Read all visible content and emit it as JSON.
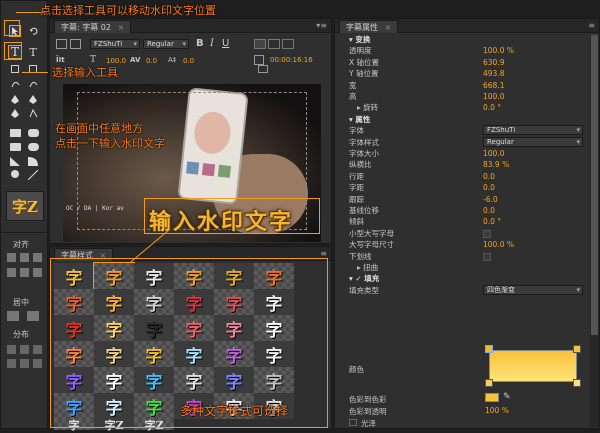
{
  "titler": {
    "tab_label": "字幕: 字幕 02",
    "font_family": "FZShuTi",
    "font_style": "Regular",
    "size": "100.0",
    "kerning": "0.0",
    "leading": "0.0",
    "timecode": "00:00:16:16",
    "text_tool_label": "T",
    "vertical_text_label": "T"
  },
  "left_panel": {
    "align_label": "对齐",
    "center_label": "居中",
    "distribute_label": "分布",
    "style_preview": "字Z"
  },
  "video": {
    "watermark_text": "输入水印文字",
    "ticker_text": "OC / DA | Kor av"
  },
  "styles_panel": {
    "tab_label": "字幕样式",
    "swatch_glyph": "字",
    "bottom_swatches": [
      "字",
      "字Z",
      "字Z"
    ]
  },
  "properties_panel": {
    "tab_label": "字幕属性",
    "rows": [
      {
        "label": "变换",
        "value": "",
        "type": "head"
      },
      {
        "label": "透明度",
        "value": "100.0 %"
      },
      {
        "label": "X 轴位置",
        "value": "630.9"
      },
      {
        "label": "Y 轴位置",
        "value": "493.8"
      },
      {
        "label": "宽",
        "value": "668.1"
      },
      {
        "label": "高",
        "value": "100.0"
      },
      {
        "label": "旋转",
        "value": "0.0 °",
        "indent": true
      },
      {
        "label": "属性",
        "value": "",
        "type": "head"
      },
      {
        "label": "字体",
        "value": "FZShuTi",
        "type": "dropdown"
      },
      {
        "label": "字体样式",
        "value": "Regular",
        "type": "dropdown"
      },
      {
        "label": "字体大小",
        "value": "100.0"
      },
      {
        "label": "纵横比",
        "value": "83.9 %"
      },
      {
        "label": "行距",
        "value": "0.0"
      },
      {
        "label": "字距",
        "value": "0.0"
      },
      {
        "label": "跟踪",
        "value": "-6.0"
      },
      {
        "label": "基线位移",
        "value": "0.0"
      },
      {
        "label": "倾斜",
        "value": "0.0 °"
      },
      {
        "label": "小型大写字母",
        "value": "",
        "type": "checkbox"
      },
      {
        "label": "大写字母尺寸",
        "value": "100.0 %"
      },
      {
        "label": "下划线",
        "value": "",
        "type": "checkbox"
      },
      {
        "label": "扭曲",
        "value": "",
        "indent": true
      },
      {
        "label": "填充",
        "value": "",
        "type": "headcheck"
      },
      {
        "label": "填充类型",
        "value": "四色渐变",
        "type": "dropdown"
      }
    ],
    "color_label": "颜色",
    "color_to_color_label": "色彩到色彩",
    "color_to_opacity_label": "色彩到透明",
    "color_to_opacity_value": "100 %",
    "sheen_label": "光泽"
  },
  "annotations": {
    "select_tool": "点击选择工具可以移动水印文字位置",
    "input_tool": "选择输入工具",
    "click_canvas_1": "在画面中任意地方",
    "click_canvas_2": "点击一下输入水印文字",
    "styles_hint": "多种文字样式可选择"
  },
  "colors": {
    "accent": "#f39a1e",
    "value": "#f4a523",
    "gradient_top": "#f8c23a",
    "gradient_bottom": "#ffe37a"
  }
}
